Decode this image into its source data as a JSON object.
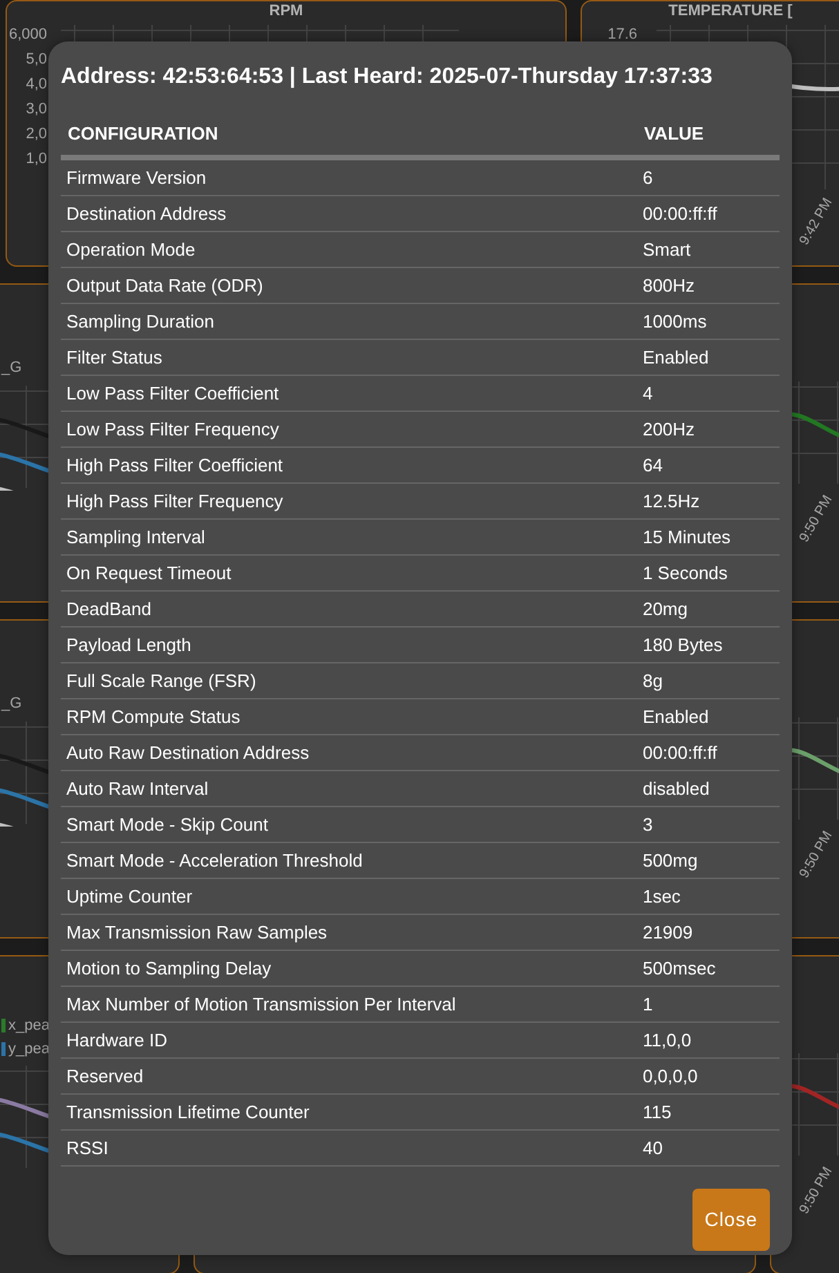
{
  "dashboard": {
    "top_panels": [
      {
        "title": "RPM",
        "y_labels": [
          "6,000",
          "5,0",
          "4,0",
          "3,0",
          "2,0",
          "1,0"
        ]
      },
      {
        "title": "TEMPERATURE [",
        "y_labels": [
          "17.6"
        ],
        "x_labels": [
          "9:42 PM"
        ]
      }
    ],
    "rows": [
      {
        "left": {
          "legend": [
            "_G"
          ]
        },
        "right": {
          "x_labels": [
            "9:50 PM"
          ]
        }
      },
      {
        "left": {
          "legend": [
            "_G"
          ]
        },
        "right": {
          "x_labels": [
            "9:50 PM"
          ]
        }
      },
      {
        "left": {
          "legend": [
            "x_pea",
            "y_pea"
          ]
        },
        "right": {
          "x_labels": [
            "9:50 PM"
          ]
        }
      }
    ]
  },
  "modal": {
    "title": "Address: 42:53:64:53 | Last Heard: 2025-07-Thursday 17:37:33",
    "columns": [
      "CONFIGURATION",
      "VALUE"
    ],
    "rows": [
      [
        "Firmware Version",
        "6"
      ],
      [
        "Destination Address",
        "00:00:ff:ff"
      ],
      [
        "Operation Mode",
        "Smart"
      ],
      [
        "Output Data Rate (ODR)",
        "800Hz"
      ],
      [
        "Sampling Duration",
        "1000ms"
      ],
      [
        "Filter Status",
        "Enabled"
      ],
      [
        "Low Pass Filter Coefficient",
        "4"
      ],
      [
        "Low Pass Filter Frequency",
        "200Hz"
      ],
      [
        "High Pass Filter Coefficient",
        "64"
      ],
      [
        "High Pass Filter Frequency",
        "12.5Hz"
      ],
      [
        "Sampling Interval",
        "15 Minutes"
      ],
      [
        "On Request Timeout",
        "1 Seconds"
      ],
      [
        "DeadBand",
        "20mg"
      ],
      [
        "Payload Length",
        "180 Bytes"
      ],
      [
        "Full Scale Range (FSR)",
        "8g"
      ],
      [
        "RPM Compute Status",
        "Enabled"
      ],
      [
        "Auto Raw Destination Address",
        "00:00:ff:ff"
      ],
      [
        "Auto Raw Interval",
        "disabled"
      ],
      [
        "Smart Mode - Skip Count",
        "3"
      ],
      [
        "Smart Mode - Acceleration Threshold",
        "500mg"
      ],
      [
        "Uptime Counter",
        "1sec"
      ],
      [
        "Max Transmission Raw Samples",
        "21909"
      ],
      [
        "Motion to Sampling Delay",
        "500msec"
      ],
      [
        "Max Number of Motion Transmission Per Interval",
        "1"
      ],
      [
        "Hardware ID",
        "11,0,0"
      ],
      [
        "Reserved",
        "0,0,0,0"
      ],
      [
        "Transmission Lifetime Counter",
        "115"
      ],
      [
        "RSSI",
        "40"
      ]
    ],
    "close_button": "Close"
  }
}
